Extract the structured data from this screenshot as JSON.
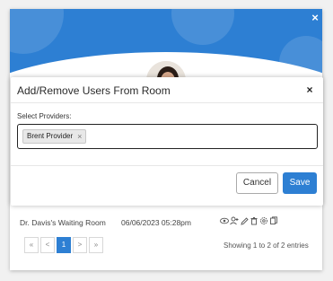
{
  "modal": {
    "title": "Add/Remove Users From Room",
    "close_label": "×",
    "field_label": "Select Providers:",
    "selected_providers": [
      {
        "name": "Brent Provider",
        "remove_label": "×"
      }
    ],
    "cancel_label": "Cancel",
    "save_label": "Save"
  },
  "header": {
    "close_label": "×"
  },
  "table": {
    "rows": [
      {
        "room": "Dr. Davis's Waiting Room",
        "date": "06/06/2023 05:28pm"
      }
    ]
  },
  "pagination": {
    "first": "«",
    "prev": "<",
    "current": "1",
    "next": ">",
    "last": "»",
    "entries_text": "Showing 1 to 2 of 2 entries"
  },
  "colors": {
    "accent": "#2d7fd3"
  },
  "icons": [
    "view-icon",
    "add-user-icon",
    "edit-icon",
    "delete-icon",
    "settings-icon",
    "copy-icon"
  ]
}
